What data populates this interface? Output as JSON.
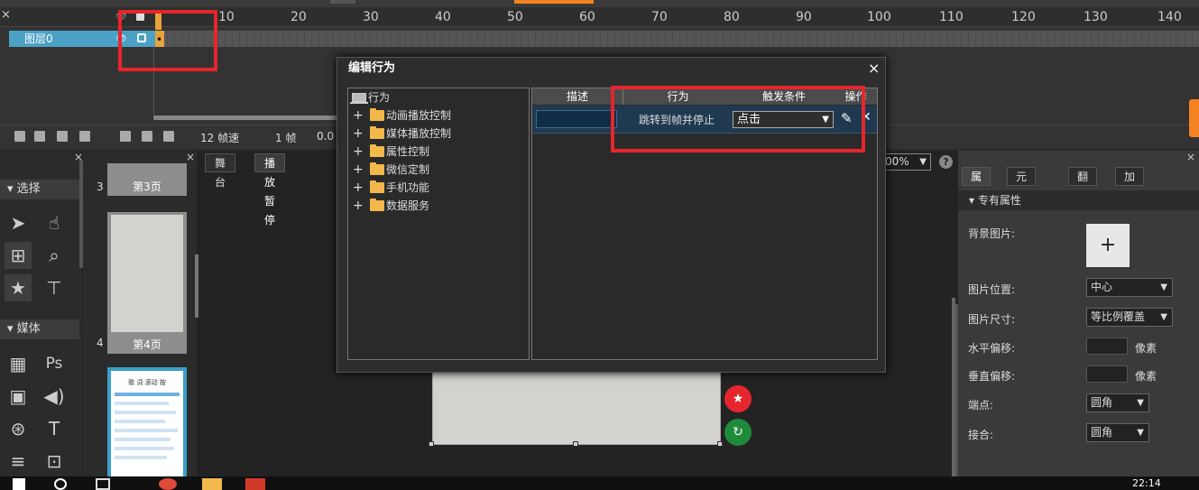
{
  "timeline": {
    "close": "×",
    "eye_header": "👁",
    "ticks": [
      "10",
      "20",
      "30",
      "40",
      "50",
      "60",
      "70",
      "80",
      "90",
      "100",
      "110",
      "120",
      "130",
      "140"
    ],
    "layer_name": "图层0",
    "fps": "12 帧速",
    "frame": "1 帧",
    "time": "0.0"
  },
  "toolbox": {
    "close": "×",
    "section_select": "选择",
    "section_media": "媒体"
  },
  "pages": {
    "close": "×",
    "items": [
      {
        "num": "3",
        "label": "第3页"
      },
      {
        "num": "4",
        "label": "第4页"
      }
    ],
    "mini_title": "歌 词 滚动 按"
  },
  "stage": {
    "tabs": [
      "舞台",
      "播放暂停"
    ],
    "zoom": "00%",
    "help": "?"
  },
  "props": {
    "close": "×",
    "tabs": [
      "属性",
      "元件",
      "翻页",
      "加载"
    ],
    "section": "专有属性",
    "bg_image_label": "背景图片:",
    "add_symbol": "+",
    "img_pos_label": "图片位置:",
    "img_pos_value": "中心",
    "img_size_label": "图片尺寸:",
    "img_size_value": "等比例覆盖",
    "h_offset_label": "水平偏移:",
    "v_offset_label": "垂直偏移:",
    "unit": "像素",
    "corner_label": "端点:",
    "corner_value": "圆角",
    "join_label": "接合:",
    "join_value": "圆角"
  },
  "dialog": {
    "title": "编辑行为",
    "close": "×",
    "tree_root": "行为",
    "tree_items": [
      "动画播放控制",
      "媒体播放控制",
      "属性控制",
      "微信定制",
      "手机功能",
      "数据服务"
    ],
    "columns": [
      "描述",
      "行为",
      "触发条件",
      "操作"
    ],
    "row": {
      "action": "跳转到帧并停止",
      "trigger": "点击"
    }
  },
  "taskbar": {
    "time": "22:14"
  },
  "colors": {
    "highlight_red": "#e5262c",
    "layer_blue": "#4aa0c5",
    "accent_orange": "#f58220",
    "fab_red": "#e5262c",
    "fab_green": "#1f8a3a"
  }
}
